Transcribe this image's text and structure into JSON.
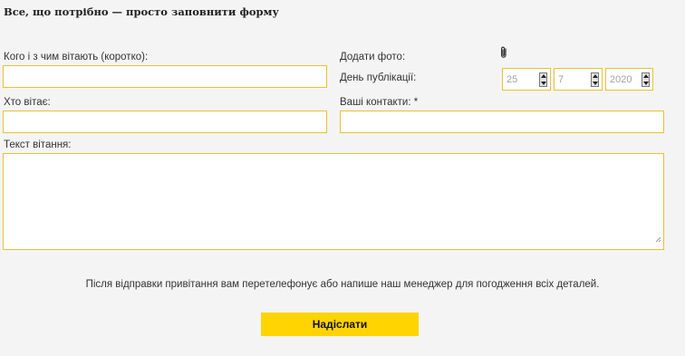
{
  "form": {
    "heading": "Все, що потрібно — просто заповнити форму",
    "who_greeted_label": "Кого і з чим вітають (коротко):",
    "who_greets_label": "Хто вітає:",
    "message_label": "Текст вітання:",
    "add_photo_label": "Додати фото:",
    "publication_day_label": "День публікації:",
    "contacts_label": "Ваші контакти: *",
    "date": {
      "day": "25",
      "month": "7",
      "year": "2020"
    },
    "note": "Після відправки привітання вам перетелефонує або напише наш менеджер для погодження всіх деталей.",
    "submit_label": "Надіслати"
  },
  "icons": {
    "attach": "paperclip-icon",
    "spinner": "spin-arrows-icon",
    "resize": "resize-grip-icon"
  },
  "colors": {
    "accent": "#ffd400",
    "field_border": "#e8c232",
    "background": "#f4f4f4"
  }
}
